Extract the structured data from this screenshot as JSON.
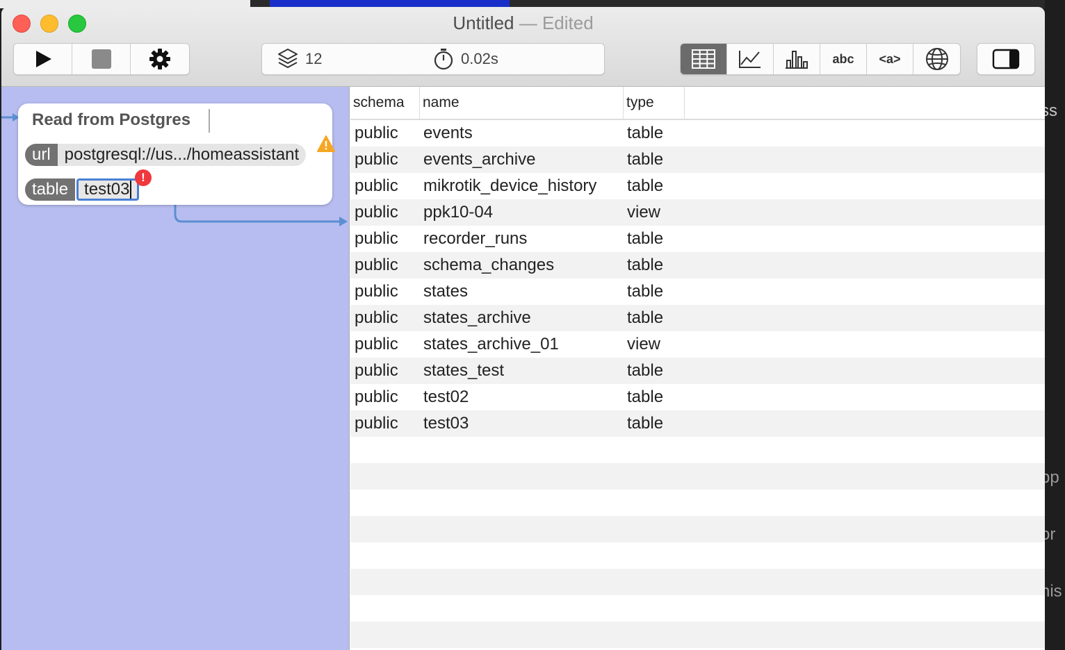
{
  "window": {
    "title": "Untitled",
    "title_suffix": "— Edited"
  },
  "toolbar": {
    "run_controls": [
      {
        "name": "play-icon"
      },
      {
        "name": "stop-icon"
      },
      {
        "name": "gear-icon"
      }
    ],
    "stats": {
      "layers_count": "12",
      "elapsed": "0.02s"
    },
    "view_modes": [
      {
        "name": "grid-view-icon",
        "active": true
      },
      {
        "name": "line-chart-icon",
        "active": false
      },
      {
        "name": "bar-chart-icon",
        "active": false
      },
      {
        "name": "text-view-label",
        "label": "abc",
        "active": false
      },
      {
        "name": "html-view-label",
        "label": "<a>",
        "active": false
      },
      {
        "name": "globe-icon",
        "active": false
      }
    ],
    "sidebar_toggle": {
      "name": "sidebar-toggle-icon"
    }
  },
  "node": {
    "title": "Read from Postgres",
    "params": [
      {
        "key": "url",
        "value": "postgresql://us.../homeassistant",
        "status": "warning"
      },
      {
        "key": "table",
        "value": "test03",
        "status": "error"
      }
    ],
    "error_glyph": "!"
  },
  "table": {
    "columns": [
      "schema",
      "name",
      "type"
    ],
    "rows": [
      [
        "public",
        "events",
        "table"
      ],
      [
        "public",
        "events_archive",
        "table"
      ],
      [
        "public",
        "mikrotik_device_history",
        "table"
      ],
      [
        "public",
        "ppk10-04",
        "view"
      ],
      [
        "public",
        "recorder_runs",
        "table"
      ],
      [
        "public",
        "schema_changes",
        "table"
      ],
      [
        "public",
        "states",
        "table"
      ],
      [
        "public",
        "states_archive",
        "table"
      ],
      [
        "public",
        "states_archive_01",
        "view"
      ],
      [
        "public",
        "states_test",
        "table"
      ],
      [
        "public",
        "test02",
        "table"
      ],
      [
        "public",
        "test03",
        "table"
      ]
    ]
  },
  "background_fragments": [
    "ss",
    "pp",
    "or",
    "his"
  ],
  "colors": {
    "canvas": "#b7bdf0",
    "connector": "#5b8fd1",
    "error": "#f0383d",
    "warning": "#f6a623",
    "active_segment": "#6b6b6b"
  }
}
